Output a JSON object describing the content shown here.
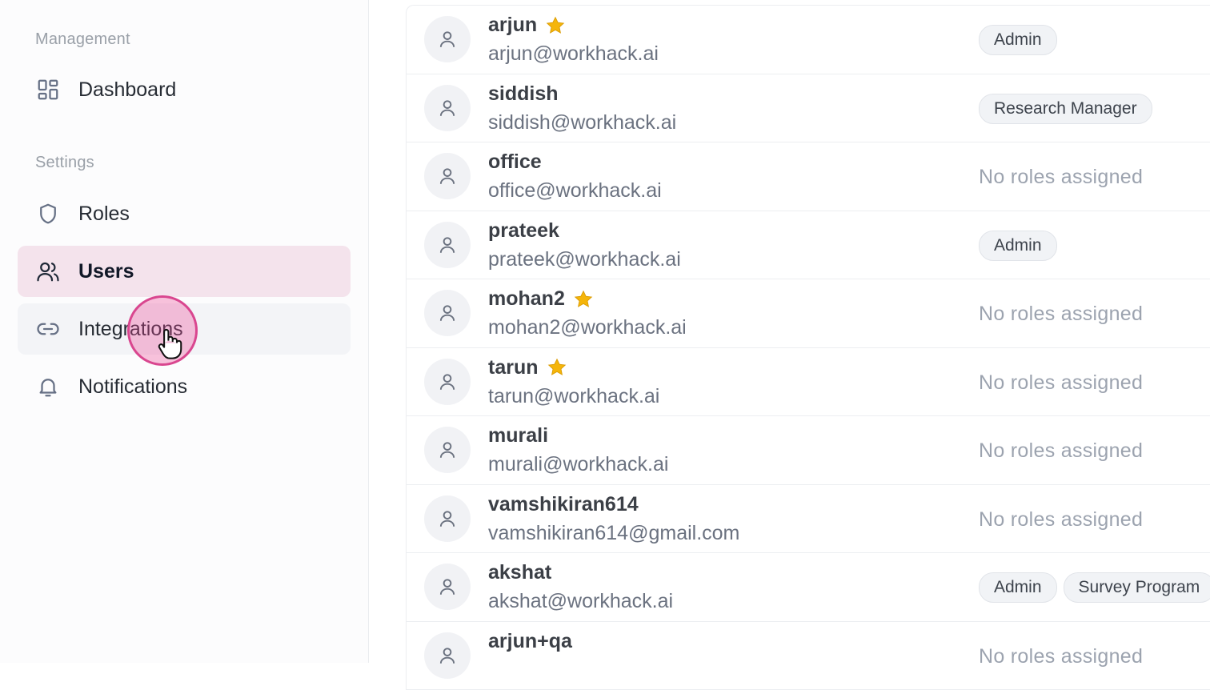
{
  "sidebar": {
    "sections": [
      {
        "label": "Management"
      },
      {
        "label": "Settings"
      }
    ],
    "items": [
      {
        "label": "Dashboard",
        "icon": "dashboard-icon"
      },
      {
        "label": "Roles",
        "icon": "shield-icon"
      },
      {
        "label": "Users",
        "icon": "users-icon",
        "active": true
      },
      {
        "label": "Integrations",
        "icon": "link-icon",
        "hovered": true
      },
      {
        "label": "Notifications",
        "icon": "bell-icon"
      }
    ]
  },
  "users": [
    {
      "name": "arjun",
      "email": "arjun@workhack.ai",
      "starred": true,
      "roles": [
        "Admin"
      ]
    },
    {
      "name": "siddish",
      "email": "siddish@workhack.ai",
      "starred": false,
      "roles": [
        "Research Manager"
      ]
    },
    {
      "name": "office",
      "email": "office@workhack.ai",
      "starred": false,
      "roles": []
    },
    {
      "name": "prateek",
      "email": "prateek@workhack.ai",
      "starred": false,
      "roles": [
        "Admin"
      ]
    },
    {
      "name": "mohan2",
      "email": "mohan2@workhack.ai",
      "starred": true,
      "roles": []
    },
    {
      "name": "tarun",
      "email": "tarun@workhack.ai",
      "starred": true,
      "roles": []
    },
    {
      "name": "murali",
      "email": "murali@workhack.ai",
      "starred": false,
      "roles": []
    },
    {
      "name": "vamshikiran614",
      "email": "vamshikiran614@gmail.com",
      "starred": false,
      "roles": []
    },
    {
      "name": "akshat",
      "email": "akshat@workhack.ai",
      "starred": false,
      "roles": [
        "Admin",
        "Survey Program"
      ]
    },
    {
      "name": "arjun+qa",
      "email": "",
      "starred": false,
      "roles": []
    }
  ],
  "no_roles_text": "No roles assigned",
  "colors": {
    "accent_bg": "#f4e3ec",
    "star": "#f5b50a",
    "cursor": "#d9468f"
  }
}
